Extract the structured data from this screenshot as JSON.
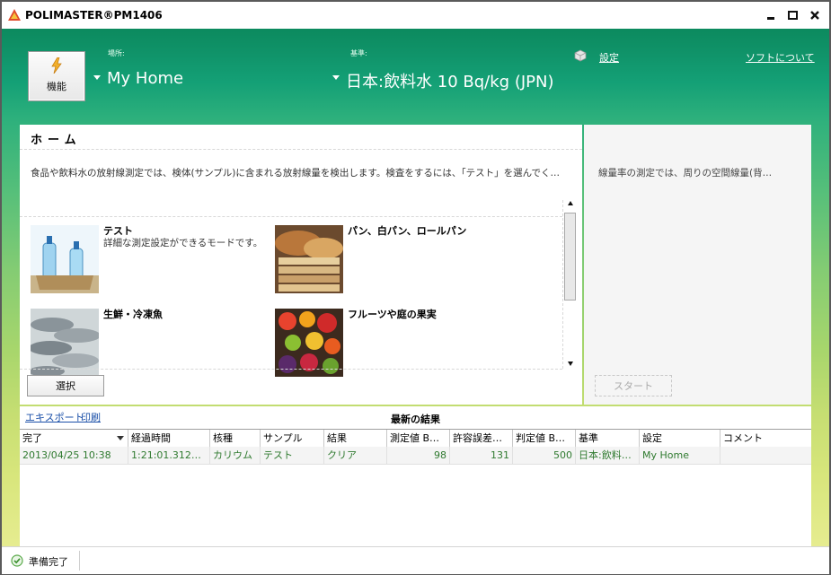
{
  "window": {
    "title": "POLIMASTER®PM1406"
  },
  "toolbar": {
    "function_label": "機能",
    "location_caption": "場所:",
    "location_value": "My Home",
    "standard_caption": "基準:",
    "standard_value": "日本:飲料水 10 Bq/kg (JPN)",
    "settings_link": "設定",
    "about_link": "ソフトについて"
  },
  "home": {
    "title": "ホーム",
    "description": "食品や飲料水の放射線測定では、検体(サンプル)に含まれる放射線量を検出します。検査をするには、「テスト」を選んでく…",
    "cards": [
      {
        "title": "テスト",
        "subtitle": "詳細な測定設定ができるモードです。"
      },
      {
        "title": "パン、白パン、ロールパン",
        "subtitle": ""
      },
      {
        "title": "生鮮・冷凍魚",
        "subtitle": ""
      },
      {
        "title": "フルーツや庭の果実",
        "subtitle": ""
      }
    ],
    "select_button": "選択"
  },
  "dose_panel": {
    "description": "線量率の測定では、周りの空間線量(背…",
    "start_button": "スタート"
  },
  "results": {
    "export_link": "エキスポート",
    "print_link": "印刷",
    "title": "最新の結果",
    "columns": [
      "完了",
      "経過時間",
      "核種",
      "サンプル",
      "結果",
      "測定値 B…",
      "許容誤差…",
      "判定値 B…",
      "基準",
      "設定",
      "コメント"
    ],
    "rows": [
      [
        "2013/04/25 10:38",
        "1:21:01.312…",
        "カリウム",
        "テスト",
        "クリア",
        "98",
        "131",
        "500",
        "日本:飲料…",
        "My Home",
        ""
      ]
    ]
  },
  "status": {
    "text": "準備完了"
  },
  "colors": {
    "header_green": "#0c8a5e",
    "result_green": "#2f7a2f",
    "link_blue": "#1a4fa8"
  }
}
